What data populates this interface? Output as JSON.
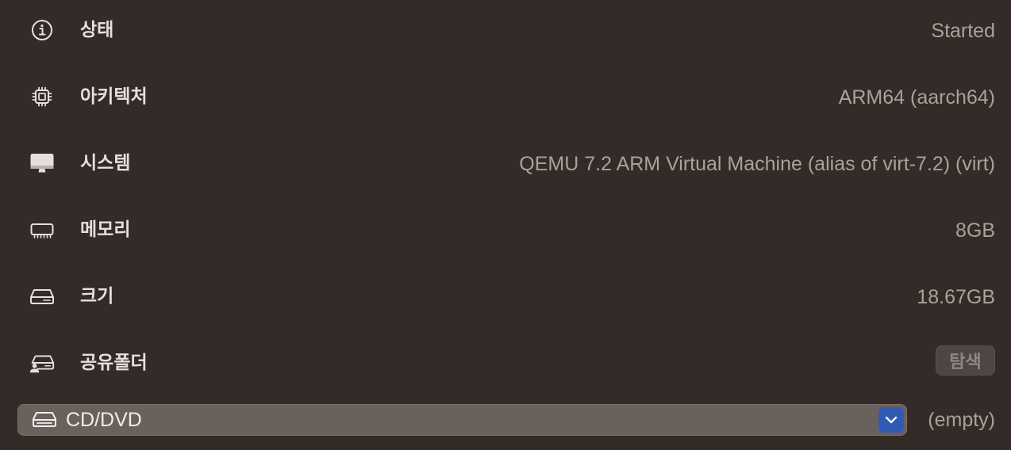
{
  "rows": [
    {
      "icon": "info-circle-icon",
      "label": "상태",
      "value": "Started"
    },
    {
      "icon": "cpu-chip-icon",
      "label": "아키텍처",
      "value": "ARM64 (aarch64)"
    },
    {
      "icon": "desktop-display-icon",
      "label": "시스템",
      "value": "QEMU 7.2 ARM Virtual Machine (alias of virt-7.2) (virt)"
    },
    {
      "icon": "memory-module-icon",
      "label": "메모리",
      "value": "8GB"
    },
    {
      "icon": "hard-drive-icon",
      "label": "크기",
      "value": "18.67GB"
    },
    {
      "icon": "shared-drive-icon",
      "label": "공유폴더",
      "button": "탐색"
    }
  ],
  "cd_dvd": {
    "icon": "optical-drive-icon",
    "label": "CD/DVD",
    "chevron_icon": "chevron-down-icon",
    "value": "(empty)"
  },
  "colors": {
    "background": "#342a27",
    "label": "#e6e0dd",
    "value": "#a9a19c",
    "accent": "#2f5ab6"
  }
}
